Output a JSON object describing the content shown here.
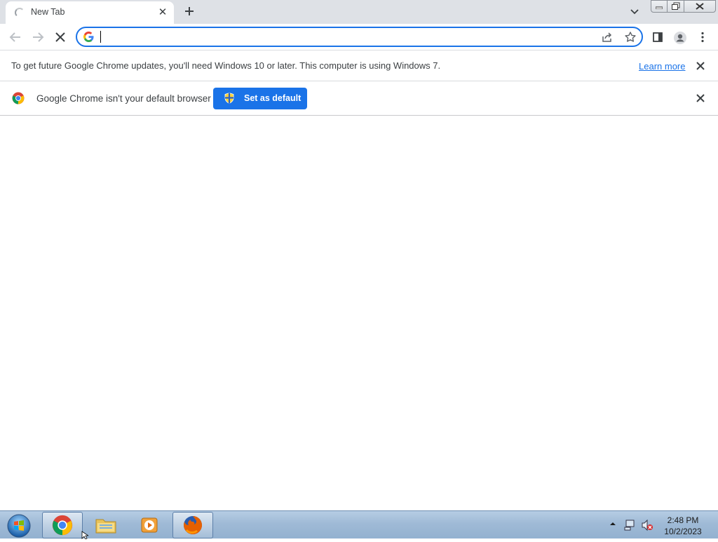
{
  "tab": {
    "title": "New Tab",
    "close_label": "✕"
  },
  "toolbar": {
    "back": "arrow-left-icon",
    "forward": "arrow-right-icon",
    "stop": "close-icon",
    "omnibox_value": ""
  },
  "infobar_update": {
    "text": "To get future Google Chrome updates, you'll need Windows 10 or later. This computer is using Windows 7.",
    "link": "Learn more"
  },
  "infobar_default": {
    "text": "Google Chrome isn't your default browser",
    "button": "Set as default"
  },
  "taskbar": {
    "apps": [
      "chrome-icon",
      "file-explorer-icon",
      "media-player-icon",
      "firefox-icon"
    ],
    "time": "2:48 PM",
    "date": "10/2/2023"
  },
  "colors": {
    "accent": "#1a73e8",
    "tabstrip": "#dee1e6",
    "taskbar": "#9fbad6"
  }
}
